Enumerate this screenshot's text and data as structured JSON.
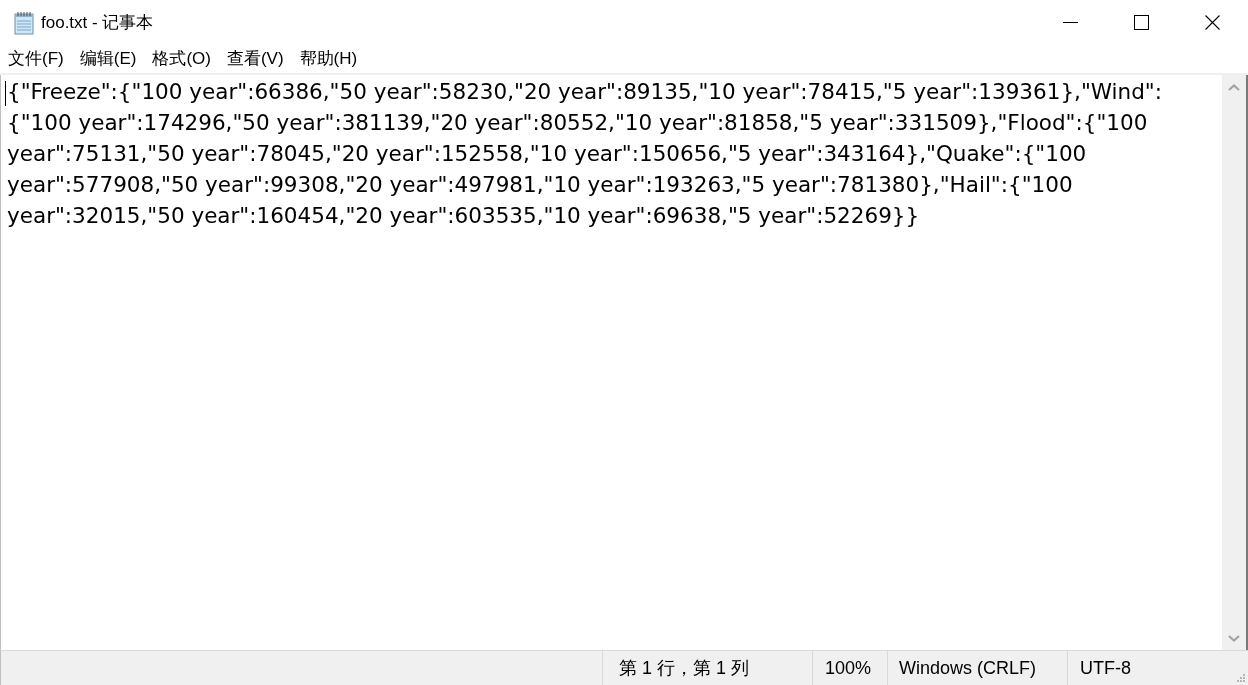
{
  "window": {
    "title": "foo.txt - 记事本"
  },
  "menu_bar": [
    "文件(F)",
    "编辑(E)",
    "格式(O)",
    "查看(V)",
    "帮助(H)"
  ],
  "document": {
    "lines": [
      "{\"Freeze\":{\"100 year\":66386,\"50 year\":58230,\"20 year\":89135,\"10 year\":78415,\"5 year\":139361},\"Wind\":",
      "{\"100 year\":174296,\"50 year\":381139,\"20 year\":80552,\"10 year\":81858,\"5 year\":331509},\"Flood\":{\"100",
      "year\":75131,\"50 year\":78045,\"20 year\":152558,\"10 year\":150656,\"5 year\":343164},\"Quake\":{\"100",
      "year\":577908,\"50 year\":99308,\"20 year\":497981,\"10 year\":193263,\"5 year\":781380},\"Hail\":{\"100",
      "year\":32015,\"50 year\":160454,\"20 year\":603535,\"10 year\":69638,\"5 year\":52269}}"
    ]
  },
  "status_bar": [
    "第 1 行，第 1 列",
    "100%",
    "Windows (CRLF)",
    "UTF-8"
  ]
}
